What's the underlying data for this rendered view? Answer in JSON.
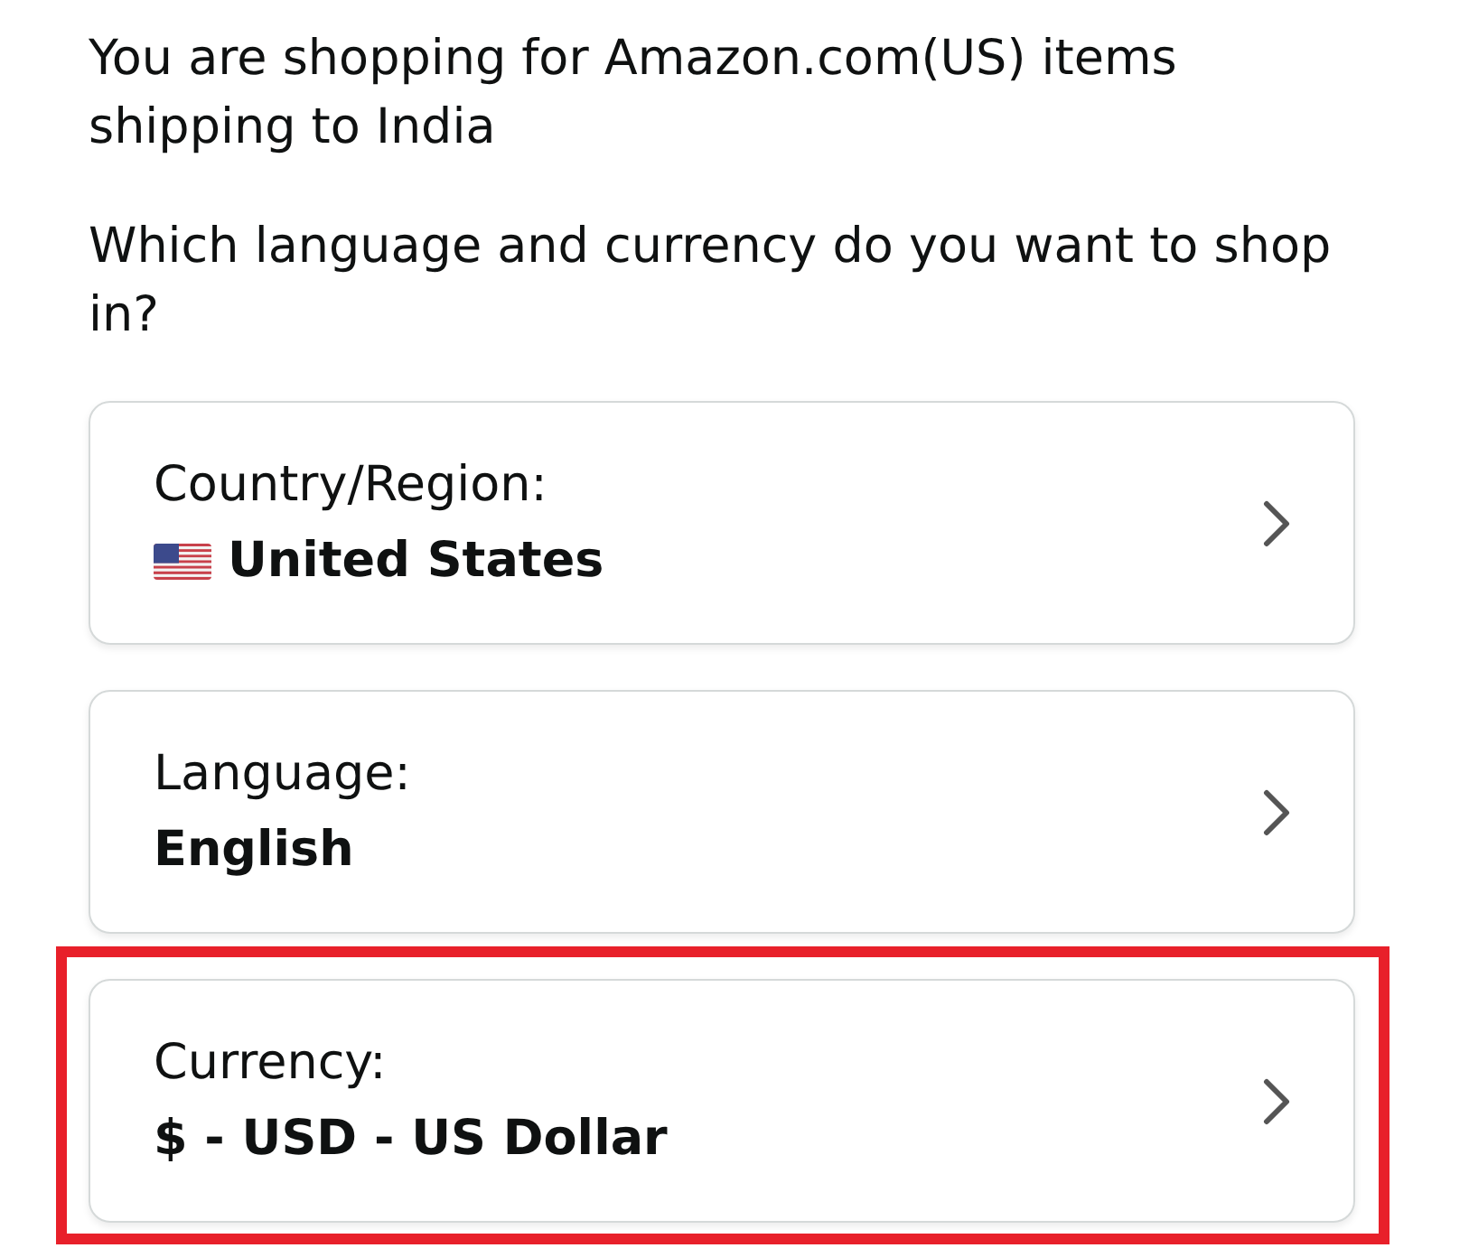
{
  "intro": "You are shopping for Amazon.com(US) items shipping to India",
  "question": "Which language and currency do you want to shop in?",
  "options": [
    {
      "kind": "country",
      "label": "Country/Region:",
      "value": "United States",
      "highlighted": false
    },
    {
      "kind": "plain",
      "label": "Language:",
      "value": "English",
      "highlighted": false
    },
    {
      "kind": "plain",
      "label": "Currency:",
      "value": "$ - USD - US Dollar",
      "highlighted": true
    }
  ]
}
